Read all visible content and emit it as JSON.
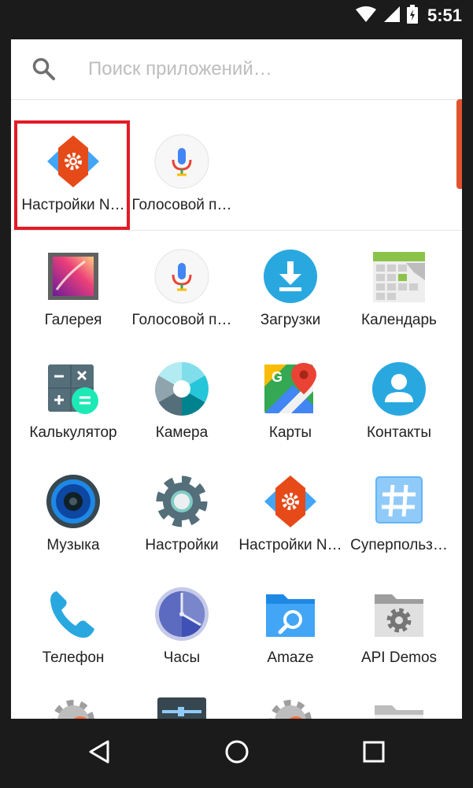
{
  "status_bar": {
    "time": "5:51",
    "icons": [
      "wifi-icon",
      "signal-icon",
      "battery-icon"
    ]
  },
  "search": {
    "placeholder": "Поиск приложений…"
  },
  "suggested_apps": [
    {
      "label": "Настройки N…",
      "icon": "nova-settings-icon"
    },
    {
      "label": "Голосовой п…",
      "icon": "voice-search-icon"
    }
  ],
  "apps": [
    {
      "label": "Галерея",
      "icon": "gallery-icon"
    },
    {
      "label": "Голосовой п…",
      "icon": "voice-search-icon"
    },
    {
      "label": "Загрузки",
      "icon": "downloads-icon"
    },
    {
      "label": "Календарь",
      "icon": "calendar-icon"
    },
    {
      "label": "Калькулятор",
      "icon": "calculator-icon"
    },
    {
      "label": "Камера",
      "icon": "camera-icon"
    },
    {
      "label": "Карты",
      "icon": "maps-icon"
    },
    {
      "label": "Контакты",
      "icon": "contacts-icon"
    },
    {
      "label": "Музыка",
      "icon": "music-icon"
    },
    {
      "label": "Настройки",
      "icon": "settings-icon"
    },
    {
      "label": "Настройки N…",
      "icon": "nova-settings-icon"
    },
    {
      "label": "Суперпольз…",
      "icon": "superuser-icon"
    },
    {
      "label": "Телефон",
      "icon": "phone-icon"
    },
    {
      "label": "Часы",
      "icon": "clock-icon"
    },
    {
      "label": "Amaze",
      "icon": "amaze-icon"
    },
    {
      "label": "API Demos",
      "icon": "api-demos-icon"
    }
  ],
  "colors": {
    "accent": "#e0542e",
    "highlight": "#e11c25",
    "nav_bar": "#1b1b1b",
    "drawer": "#ffffff"
  },
  "nav": {
    "icons": [
      "back-icon",
      "home-icon",
      "recents-icon"
    ]
  }
}
